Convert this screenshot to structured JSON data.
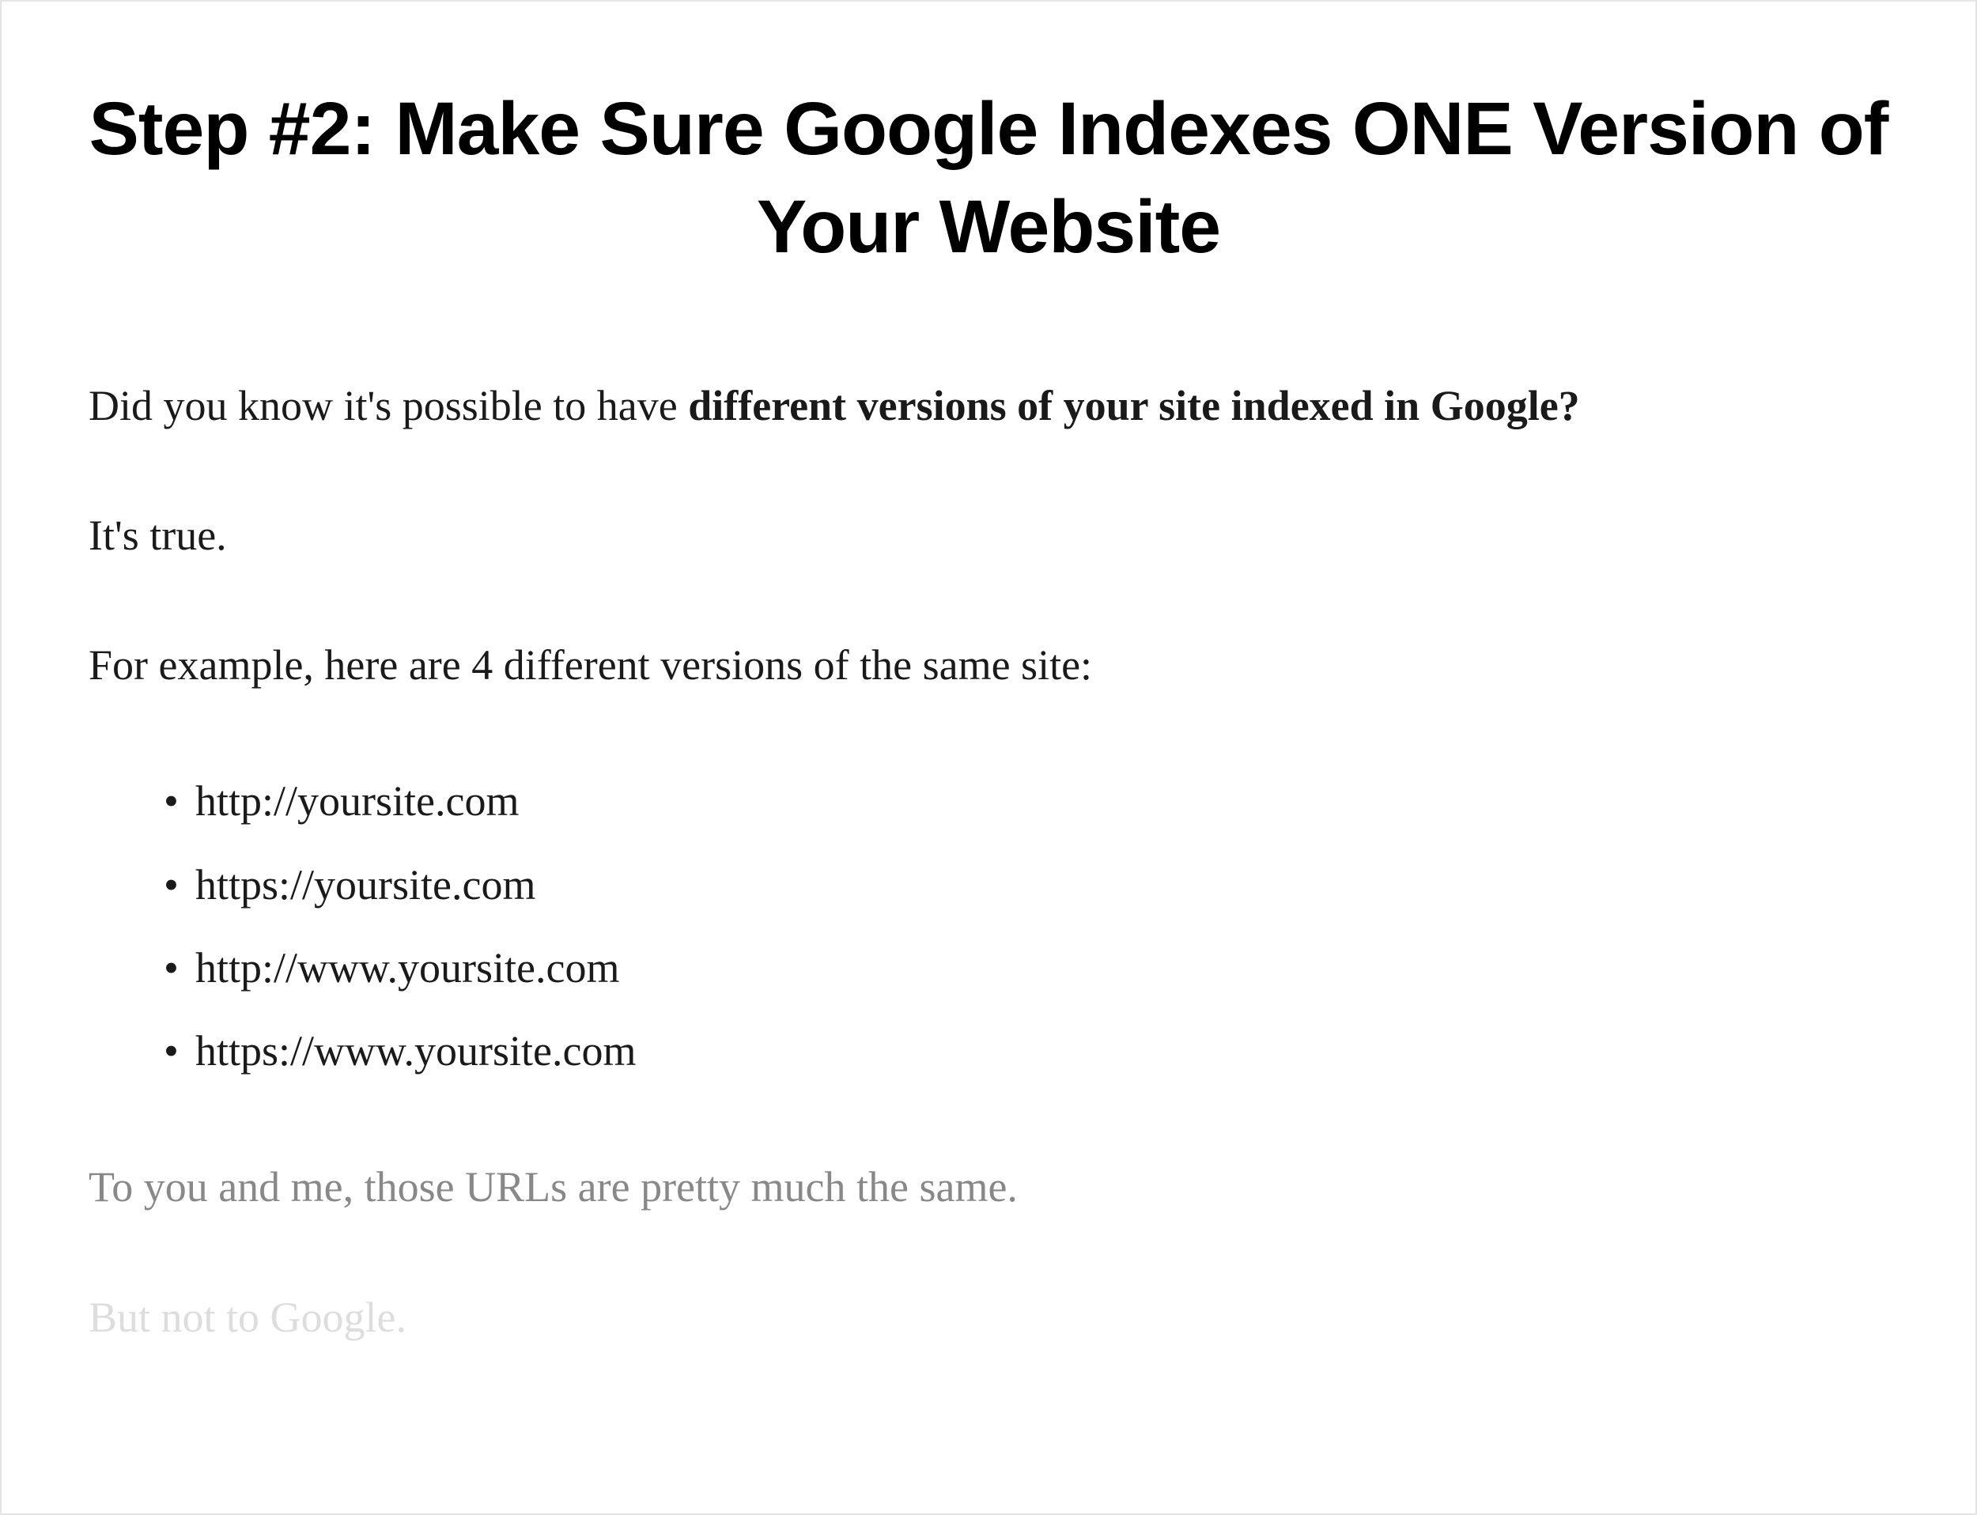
{
  "heading": "Step #2: Make Sure Google Indexes ONE Version of Your Website",
  "intro": {
    "prefix": "Did you know it's possible to have ",
    "bold": "different versions of your site indexed in Google?"
  },
  "p2": "It's true.",
  "p3": "For example, here are 4 different versions of the same site:",
  "urls": [
    "http://yoursite.com",
    "https://yoursite.com",
    "http://www.yoursite.com",
    "https://www.yoursite.com"
  ],
  "p4": "To you and me, those URLs are pretty much the same.",
  "p5": "But not to Google."
}
